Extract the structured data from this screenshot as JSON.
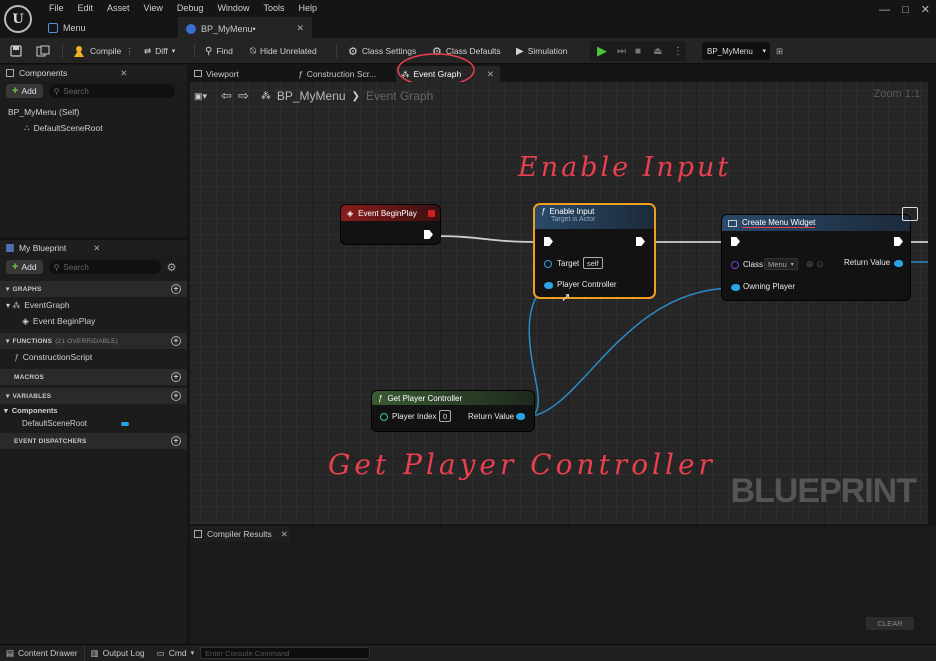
{
  "app": {
    "logo": "U"
  },
  "menu": [
    "File",
    "Edit",
    "Asset",
    "View",
    "Debug",
    "Window",
    "Tools",
    "Help"
  ],
  "doc_tabs": [
    {
      "label": "Menu"
    },
    {
      "label": "BP_MyMenu•"
    }
  ],
  "window_controls": [
    "—",
    "□",
    "✕"
  ],
  "toolbar": {
    "compile": "Compile",
    "diff": "Diff",
    "find": "Find",
    "hide_unrelated": "Hide Unrelated",
    "class_settings": "Class Settings",
    "class_defaults": "Class Defaults",
    "simulation": "Simulation",
    "debug_object": "BP_MyMenu"
  },
  "components_panel": {
    "title": "Components",
    "add": "Add",
    "search_placeholder": "Search",
    "items": [
      "BP_MyMenu (Self)",
      "DefaultSceneRoot"
    ]
  },
  "my_blueprint": {
    "title": "My Blueprint",
    "add": "Add",
    "search_placeholder": "Search",
    "sections": {
      "graphs": "GRAPHS",
      "functions": "FUNCTIONS",
      "functions_count": "(21 OVERRIDABLE)",
      "macros": "MACROS",
      "variables": "VARIABLES",
      "dispatchers": "EVENT DISPATCHERS"
    },
    "event_graph": "EventGraph",
    "event_begin_play": "Event BeginPlay",
    "construction_script": "ConstructionScript",
    "components_cat": "Components",
    "default_scene_root": "DefaultSceneRoot"
  },
  "editor_tabs": [
    "Viewport",
    "Construction Scr...",
    "Event Graph"
  ],
  "breadcrumb": {
    "root": "BP_MyMenu",
    "sep": "❯",
    "current": "Event Graph"
  },
  "zoom": "Zoom 1:1",
  "watermark": "BLUEPRINT",
  "nodes": {
    "begin_play": {
      "title": "Event BeginPlay"
    },
    "enable_input": {
      "title": "Enable Input",
      "subtitle": "Target is Actor",
      "target": "Target",
      "target_value": "self",
      "player_controller": "Player Controller"
    },
    "create_widget": {
      "title": "Create Menu Widget",
      "class": "Class",
      "class_value": "Menu",
      "return_value": "Return Value",
      "owning_player": "Owning Player"
    },
    "get_pc": {
      "title": "Get Player Controller",
      "player_index": "Player Index",
      "player_index_value": "0",
      "return_value": "Return Value"
    }
  },
  "annotations": {
    "enable_input": "Enable Input",
    "get_pc": "Get Player Controller"
  },
  "compiler": {
    "title": "Compiler Results",
    "clear": "CLEAR"
  },
  "statusbar": {
    "content_drawer": "Content Drawer",
    "output_log": "Output Log",
    "cmd": "Cmd",
    "console_placeholder": "Enter Console Command"
  },
  "colors": {
    "exec_event_header": "#8a1c1c",
    "function_header": "#2a4a6a",
    "pure_header": "#3a5a34",
    "selection": "#f0a020",
    "pin_object": "#2aa4e8",
    "annotation": "#e8404f"
  }
}
